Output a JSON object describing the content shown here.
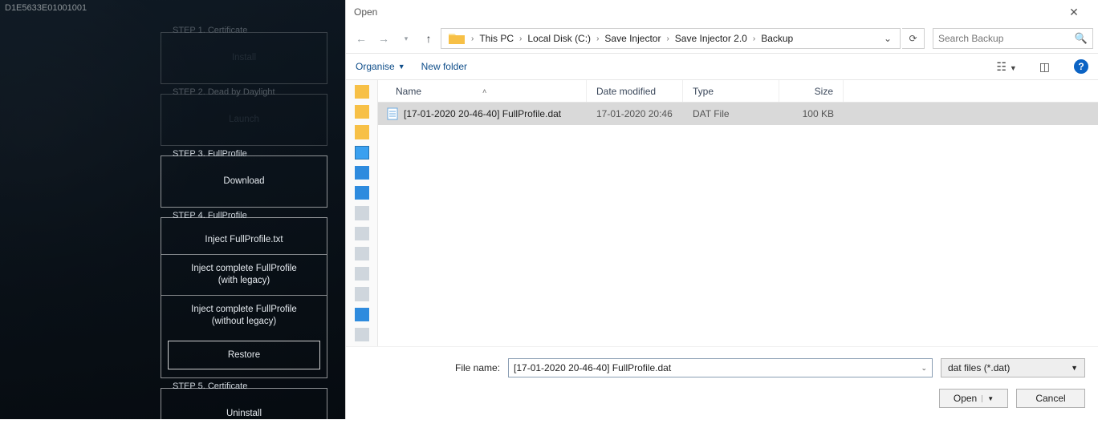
{
  "injector": {
    "window_title": "D1E5633E01001001",
    "steps": [
      {
        "label": "STEP 1. Certificate",
        "buttons": [
          "Install"
        ],
        "dim": true
      },
      {
        "label": "STEP 2. Dead by Daylight",
        "buttons": [
          "Launch"
        ],
        "dim": true
      },
      {
        "label": "STEP 3. FullProfile",
        "buttons": [
          "Download"
        ]
      },
      {
        "label": "STEP 4. FullProfile",
        "buttons": [
          "Inject FullProfile.txt",
          "Inject complete FullProfile\n(with legacy)",
          "Inject complete FullProfile\n(without legacy)",
          "Restore"
        ]
      },
      {
        "label": "STEP 5. Certificate",
        "buttons": [
          "Uninstall"
        ]
      }
    ]
  },
  "dialog": {
    "title": "Open",
    "breadcrumbs": [
      "This PC",
      "Local Disk (C:)",
      "Save Injector",
      "Save Injector 2.0",
      "Backup"
    ],
    "search_placeholder": "Search Backup",
    "toolbar": {
      "organise": "Organise",
      "new_folder": "New folder"
    },
    "columns": {
      "name": "Name",
      "date": "Date modified",
      "type": "Type",
      "size": "Size"
    },
    "files": [
      {
        "name": "[17-01-2020 20-46-40] FullProfile.dat",
        "date": "17-01-2020 20:46",
        "type": "DAT File",
        "size": "100 KB"
      }
    ],
    "file_name_label": "File name:",
    "file_name_value": "[17-01-2020 20-46-40] FullProfile.dat",
    "filter": "dat files (*.dat)",
    "open_btn": "Open",
    "cancel_btn": "Cancel"
  }
}
